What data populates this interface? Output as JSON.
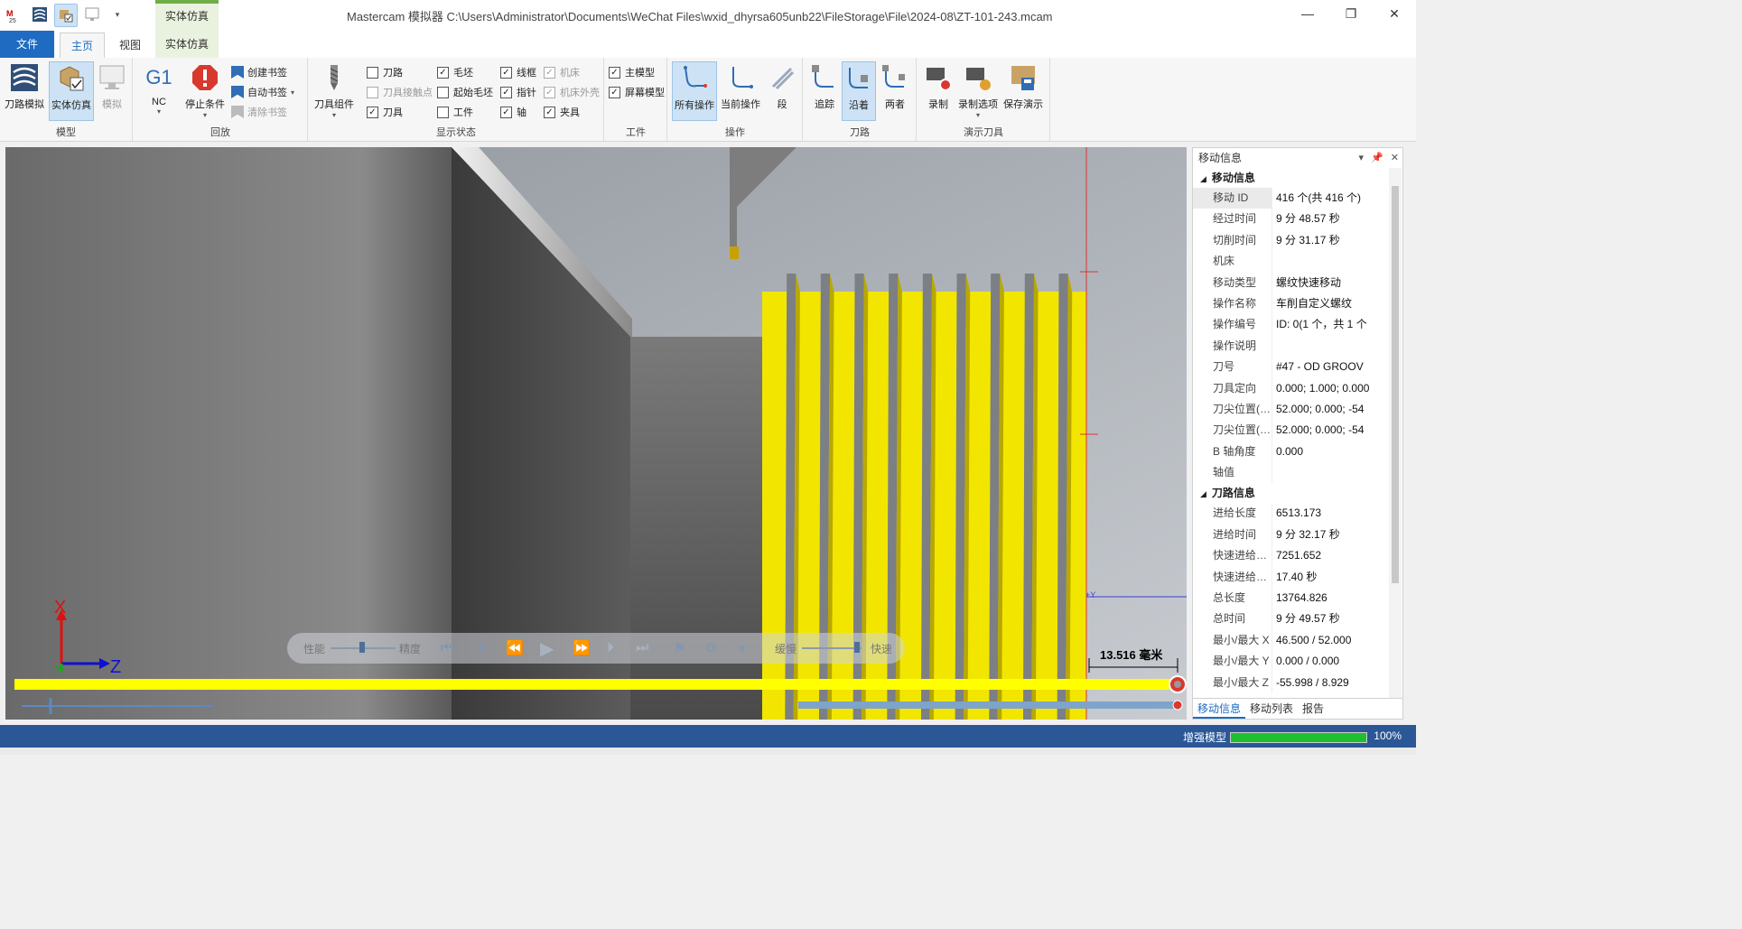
{
  "window": {
    "title": "Mastercam 模拟器  C:\\Users\\Administrator\\Documents\\WeChat Files\\wxid_dhyrsa605unb22\\FileStorage\\File\\2024-08\\ZT-101-243.mcam",
    "context_tab": "实体仿真"
  },
  "tabs": [
    "文件",
    "主页",
    "视图",
    "实体仿真"
  ],
  "ribbon": {
    "model": {
      "label": "模型",
      "toolpath_sim": "刀路模拟",
      "solid_sim": "实体仿真",
      "sim": "模拟"
    },
    "playback": {
      "label": "回放",
      "nc_title": "G1",
      "nc": "NC",
      "stop": "停止条件",
      "create_bm": "创建书签",
      "auto_bm": "自动书签",
      "clear_bm": "清除书签"
    },
    "tool_assembly": "刀具组件",
    "display": {
      "label": "显示状态",
      "items": [
        {
          "text": "刀路",
          "checked": false,
          "enabled": true
        },
        {
          "text": "刀具接触点",
          "checked": false,
          "enabled": false
        },
        {
          "text": "刀具",
          "checked": true,
          "enabled": true
        },
        {
          "text": "毛坯",
          "checked": true,
          "enabled": true
        },
        {
          "text": "起始毛坯",
          "checked": false,
          "enabled": true
        },
        {
          "text": "工件",
          "checked": false,
          "enabled": true
        },
        {
          "text": "线框",
          "checked": true,
          "enabled": true
        },
        {
          "text": "指针",
          "checked": true,
          "enabled": true
        },
        {
          "text": "轴",
          "checked": true,
          "enabled": true
        },
        {
          "text": "机床",
          "checked": true,
          "enabled": false
        },
        {
          "text": "机床外壳",
          "checked": true,
          "enabled": false
        },
        {
          "text": "夹具",
          "checked": true,
          "enabled": true
        }
      ]
    },
    "workpiece": {
      "label": "工件",
      "main_model": "主模型",
      "screen_model": "屏幕模型"
    },
    "operation": {
      "label": "操作",
      "all_ops": "所有操作",
      "current_op": "当前操作",
      "segment": "段"
    },
    "toolpath": {
      "label": "刀路",
      "trace": "追踪",
      "along": "沿着",
      "both": "两者"
    },
    "demo": {
      "label": "演示刀具",
      "record": "录制",
      "record_opts": "录制选项",
      "save_demo": "保存演示"
    }
  },
  "viewport": {
    "controls": {
      "performance": "性能",
      "precision": "精度",
      "slow": "缓慢",
      "fast": "快速"
    },
    "axes": {
      "x": "X",
      "z": "Z",
      "y": "Y",
      "y_marker": "+Y"
    },
    "scale_label": "13.516 毫米",
    "playback_progress": 1.0
  },
  "panel": {
    "title": "移动信息",
    "sections": [
      {
        "title": "移动信息",
        "rows": [
          {
            "k": "移动 ID",
            "v": "416 个(共 416 个)"
          },
          {
            "k": "经过时间",
            "v": "9 分 48.57 秒"
          },
          {
            "k": "切削时间",
            "v": "9 分 31.17 秒"
          },
          {
            "k": "机床",
            "v": ""
          },
          {
            "k": "移动类型",
            "v": "螺纹快速移动"
          },
          {
            "k": "操作名称",
            "v": "车削自定义螺纹"
          },
          {
            "k": "操作编号",
            "v": "ID: 0(1 个，共 1 个"
          },
          {
            "k": "操作说明",
            "v": ""
          },
          {
            "k": "刀号",
            "v": "#47 - OD GROOV"
          },
          {
            "k": "刀具定向",
            "v": "0.000; 1.000; 0.000"
          },
          {
            "k": "刀尖位置(WC...",
            "v": "52.000; 0.000; -54"
          },
          {
            "k": "刀尖位置(刀...",
            "v": "52.000; 0.000; -54"
          },
          {
            "k": "B 轴角度",
            "v": "0.000"
          },
          {
            "k": "轴值",
            "v": ""
          }
        ]
      },
      {
        "title": "刀路信息",
        "rows": [
          {
            "k": "进给长度",
            "v": "6513.173"
          },
          {
            "k": "进给时间",
            "v": "9 分 32.17 秒"
          },
          {
            "k": "快速进给长度",
            "v": "7251.652"
          },
          {
            "k": "快速进给时间",
            "v": "17.40 秒"
          },
          {
            "k": "总长度",
            "v": "13764.826"
          },
          {
            "k": "总时间",
            "v": "9 分 49.57 秒"
          },
          {
            "k": "最小/最大 X",
            "v": "46.500 / 52.000"
          },
          {
            "k": "最小/最大 Y",
            "v": "0.000 / 0.000"
          },
          {
            "k": "最小/最大 Z",
            "v": "-55.998 / 8.929"
          }
        ]
      }
    ],
    "tabs": [
      "移动信息",
      "移动列表",
      "报告"
    ]
  },
  "status": {
    "text": "增强模型",
    "progress": 1.0,
    "percent": "100%"
  },
  "colors": {
    "accent": "#1e6bc1",
    "status_bar": "#2b5797",
    "thread": "#f2e600",
    "progress": "#1fc02f"
  }
}
